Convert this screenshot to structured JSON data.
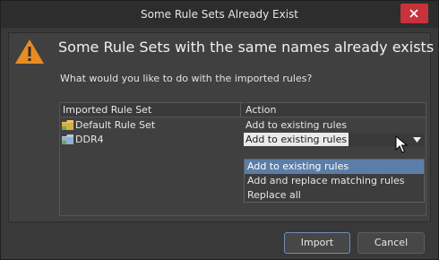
{
  "window": {
    "title": "Some Rule Sets Already Exist"
  },
  "message": {
    "headline": "Some Rule Sets with the same names already exists",
    "question": "What would you like to do with the imported rules?"
  },
  "table": {
    "columns": [
      "Imported Rule Set",
      "Action"
    ],
    "rows": [
      {
        "name": "Default Rule Set",
        "action": "Add to existing rules"
      },
      {
        "name": "DDR4",
        "action": "Add to existing rules"
      }
    ]
  },
  "dropdown": {
    "options": [
      "Add to existing rules",
      "Add and replace matching rules",
      "Replace all"
    ],
    "highlighted": "Add to existing rules"
  },
  "buttons": {
    "import_label": "Import",
    "cancel_label": "Cancel"
  },
  "icons": {
    "warning": "warning-icon",
    "folder": "folder-icon",
    "close": "close-icon",
    "dropdown": "chevron-down-icon",
    "cursor": "mouse-pointer-icon"
  },
  "colors": {
    "close": "#c8323b",
    "highlight": "#5b7ea8",
    "warning": "#e88c1f"
  }
}
